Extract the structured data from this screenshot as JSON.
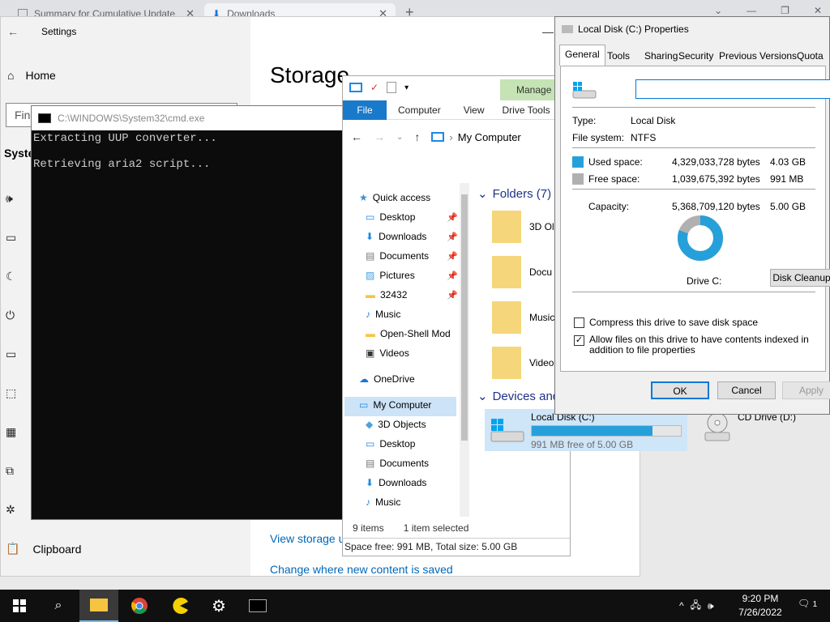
{
  "browser": {
    "tabs": [
      {
        "label": "Summary for Cumulative Update"
      },
      {
        "label": "Downloads"
      }
    ],
    "new_tab": "+"
  },
  "settings": {
    "title": "Settings",
    "home": "Home",
    "search_placeholder": "Find",
    "system": "Syste",
    "clipboard": "Clipboard",
    "heading": "Storage",
    "link_view": "View storage u",
    "link_change": "Change where new content is saved"
  },
  "cmd": {
    "title": "C:\\WINDOWS\\System32\\cmd.exe",
    "lines": [
      "Extracting UUP converter...",
      "Retrieving aria2 script..."
    ]
  },
  "explorer": {
    "manage": "Manage",
    "drive_tools": "Drive Tools",
    "ribbon": {
      "file": "File",
      "computer": "Computer",
      "view": "View"
    },
    "path": "My Computer",
    "nav": [
      {
        "label": "Quick access",
        "icon": "star-icon"
      },
      {
        "label": "Desktop",
        "icon": "desktop-icon",
        "pinned": true
      },
      {
        "label": "Downloads",
        "icon": "download-icon",
        "pinned": true
      },
      {
        "label": "Documents",
        "icon": "document-icon",
        "pinned": true
      },
      {
        "label": "Pictures",
        "icon": "pictures-icon",
        "pinned": true
      },
      {
        "label": "32432",
        "icon": "folder-icon",
        "pinned": true
      },
      {
        "label": "Music",
        "icon": "music-icon"
      },
      {
        "label": "Open-Shell Mod",
        "icon": "folder-icon"
      },
      {
        "label": "Videos",
        "icon": "video-icon"
      },
      {
        "label": "OneDrive",
        "icon": "cloud-icon"
      },
      {
        "label": "My Computer",
        "icon": "computer-icon"
      },
      {
        "label": "3D Objects",
        "icon": "cube-icon"
      },
      {
        "label": "Desktop",
        "icon": "desktop-icon"
      },
      {
        "label": "Documents",
        "icon": "document-icon"
      },
      {
        "label": "Downloads",
        "icon": "download-icon"
      },
      {
        "label": "Music",
        "icon": "music-icon"
      }
    ],
    "folders_header": "Folders (7)",
    "folders": [
      "3D Ol",
      "Docu",
      "Music",
      "Video"
    ],
    "devices_header": "Devices and",
    "status_items": "9 items",
    "status_selected": "1 item selected",
    "statusbar": "Space free: 991 MB, Total size: 5.00 GB",
    "local_disk": {
      "name": "Local Disk (C:)",
      "free": "991 MB free of 5.00 GB",
      "used_fraction": 0.81
    },
    "cd_drive": "CD Drive (D:)"
  },
  "properties": {
    "title": "Local Disk (C:) Properties",
    "tabs": [
      "General",
      "Tools",
      "Sharing",
      "Security",
      "Previous Versions",
      "Quota"
    ],
    "name_value": "",
    "type_label": "Type:",
    "type_value": "Local Disk",
    "fs_label": "File system:",
    "fs_value": "NTFS",
    "used_label": "Used space:",
    "used_bytes": "4,329,033,728 bytes",
    "used_size": "4.03 GB",
    "free_label": "Free space:",
    "free_bytes": "1,039,675,392 bytes",
    "free_size": "991 MB",
    "capacity_label": "Capacity:",
    "capacity_bytes": "5,368,709,120 bytes",
    "capacity_size": "5.00 GB",
    "drive_label": "Drive C:",
    "cleanup": "Disk Cleanup",
    "compress": "Compress this drive to save disk space",
    "index": "Allow files on this drive to have contents indexed in addition to file properties",
    "compress_checked": false,
    "index_checked": true,
    "used_fraction": 0.806,
    "ok": "OK",
    "cancel": "Cancel",
    "apply": "Apply",
    "colors": {
      "used": "#26a0da",
      "free": "#b0b0b0"
    }
  },
  "taskbar": {
    "time": "9:20 PM",
    "date": "7/26/2022",
    "notifications": "1"
  }
}
